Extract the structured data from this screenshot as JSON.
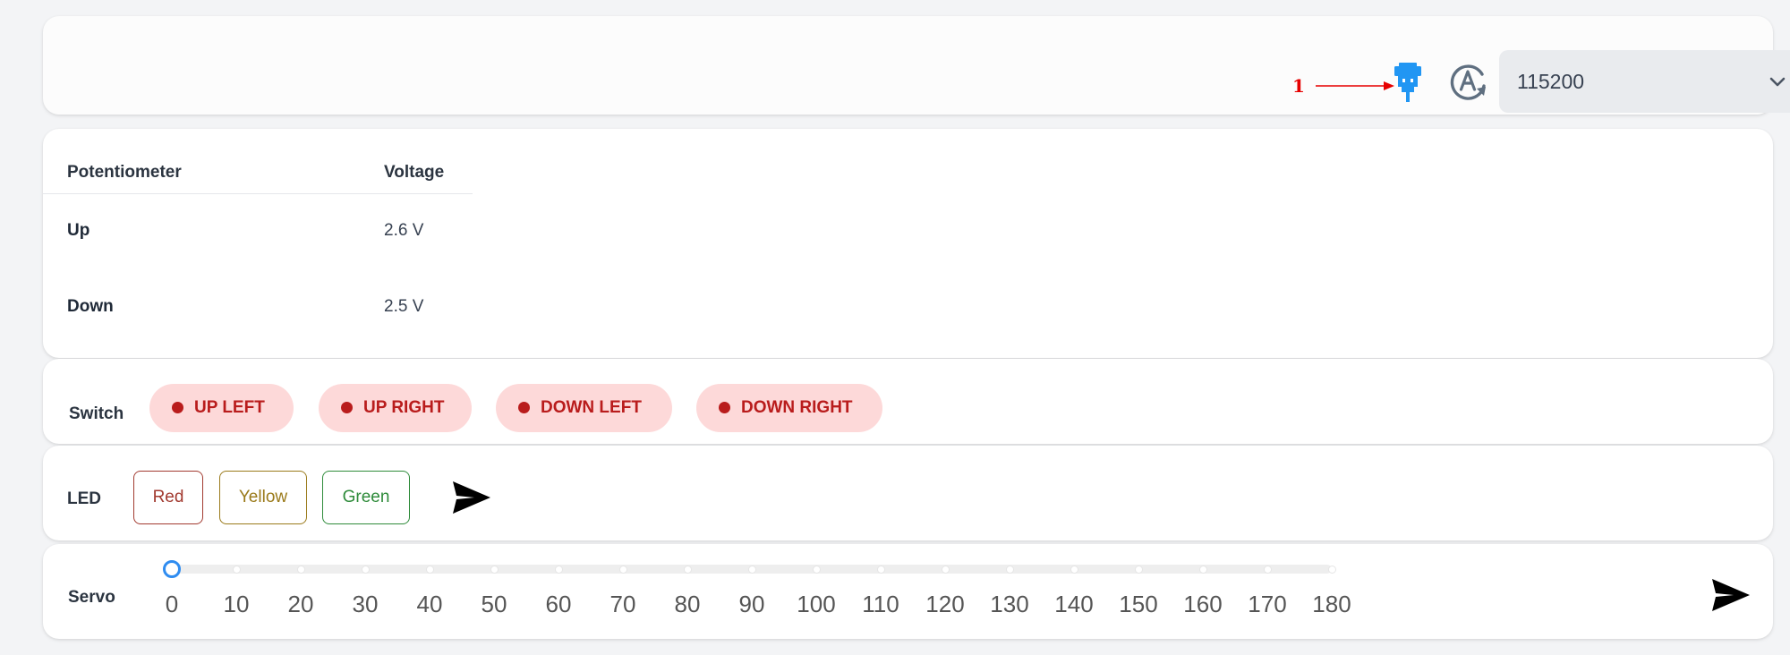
{
  "header": {
    "annotation_number": "1",
    "usb_icon": "usb-plug-icon",
    "auto_icon": "auto-mode-icon",
    "baud_rate": "115200",
    "colors": {
      "usb_icon": "#2196f3",
      "annotation": "#e60000"
    }
  },
  "potentiometer": {
    "columns": [
      "Potentiometer",
      "Voltage"
    ],
    "rows": [
      {
        "name": "Up",
        "voltage": "2.6 V"
      },
      {
        "name": "Down",
        "voltage": "2.5 V"
      }
    ]
  },
  "switch": {
    "label": "Switch",
    "chips": [
      "UP LEFT",
      "UP RIGHT",
      "DOWN LEFT",
      "DOWN RIGHT"
    ],
    "colors": {
      "chip_bg": "#fdd9d9",
      "chip_text": "#b91c1c"
    }
  },
  "led": {
    "label": "LED",
    "buttons": [
      {
        "label": "Red",
        "color": "#a23a30"
      },
      {
        "label": "Yellow",
        "color": "#9a7a1a"
      },
      {
        "label": "Green",
        "color": "#2e8b3a"
      }
    ],
    "send_icon": "send-icon"
  },
  "servo": {
    "label": "Servo",
    "min": 0,
    "max": 180,
    "value": 0,
    "ticks": [
      "0",
      "10",
      "20",
      "30",
      "40",
      "50",
      "60",
      "70",
      "80",
      "90",
      "100",
      "110",
      "120",
      "130",
      "140",
      "150",
      "160",
      "170",
      "180"
    ],
    "send_icon": "send-icon",
    "colors": {
      "thumb": "#2f8cf0"
    }
  }
}
